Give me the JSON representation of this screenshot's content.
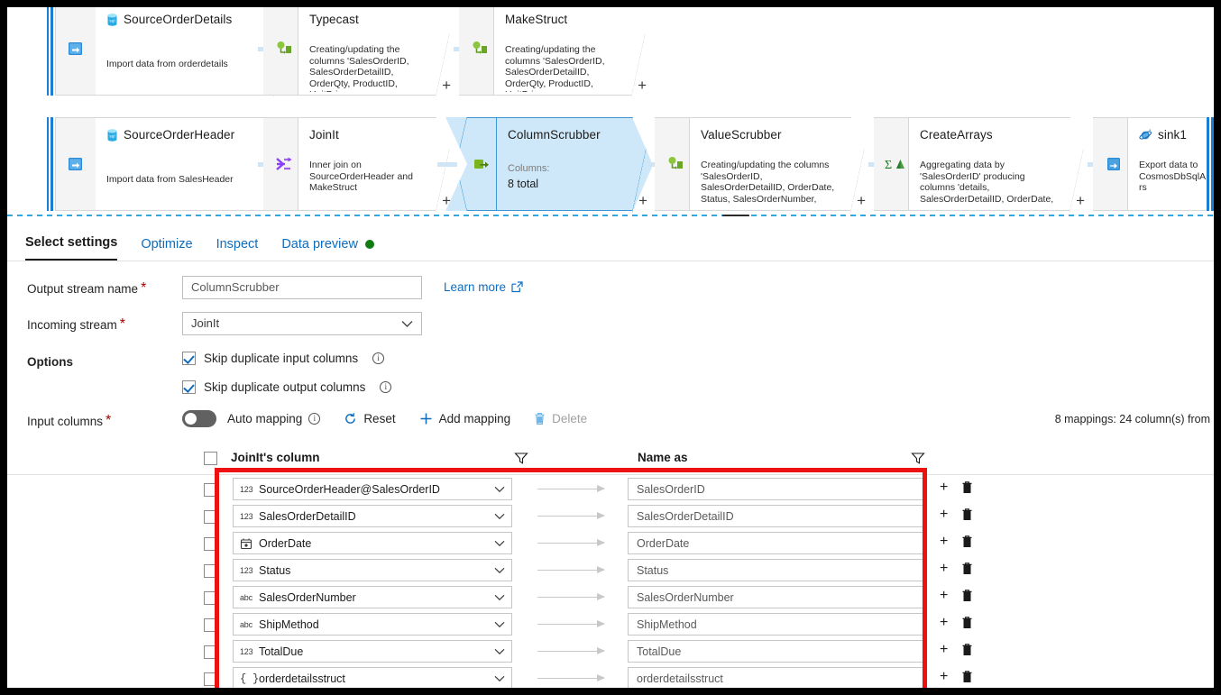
{
  "canvas": {
    "row1": [
      {
        "name": "SourceOrderDetails",
        "desc": "Import data from orderdetails",
        "icon": "sql-database-icon",
        "kind": "source"
      },
      {
        "name": "Typecast",
        "desc": "Creating/updating the columns 'SalesOrderID, SalesOrderDetailID, OrderQty, ProductID, UnitPrice,",
        "icon": "derived-column-icon",
        "kind": "transform"
      },
      {
        "name": "MakeStruct",
        "desc": "Creating/updating the columns 'SalesOrderID, SalesOrderDetailID, OrderQty, ProductID, UnitPrice,",
        "icon": "derived-column-icon",
        "kind": "transform"
      }
    ],
    "row2": [
      {
        "name": "SourceOrderHeader",
        "desc": "Import data from SalesHeader",
        "icon": "sql-database-icon",
        "kind": "source"
      },
      {
        "name": "JoinIt",
        "desc": "Inner join on SourceOrderHeader and MakeStruct",
        "icon": "join-icon",
        "kind": "transform"
      },
      {
        "name": "ColumnScrubber",
        "desc": "",
        "icon": "select-icon",
        "kind": "selected",
        "columns_label": "Columns:",
        "columns_value": "8 total"
      },
      {
        "name": "ValueScrubber",
        "desc": "Creating/updating the columns 'SalesOrderID, SalesOrderDetailID, OrderDate, Status, SalesOrderNumber,",
        "icon": "derived-column-icon",
        "kind": "transform"
      },
      {
        "name": "CreateArrays",
        "desc": "Aggregating data by 'SalesOrderID' producing columns 'details, SalesOrderDetailID, OrderDate,",
        "icon": "aggregate-icon",
        "kind": "transform"
      },
      {
        "name": "sink1",
        "desc": "Export data to CosmosDbSqlApiOrders",
        "icon": "cosmos-db-icon",
        "kind": "sink"
      }
    ],
    "plus_label": "+"
  },
  "tabs": [
    {
      "label": "Select settings",
      "active": true
    },
    {
      "label": "Optimize",
      "active": false
    },
    {
      "label": "Inspect",
      "active": false
    },
    {
      "label": "Data preview",
      "active": false,
      "indicator": "green-dot"
    }
  ],
  "form": {
    "output_stream_label": "Output stream name",
    "output_stream_value": "ColumnScrubber",
    "incoming_stream_label": "Incoming stream",
    "incoming_stream_value": "JoinIt",
    "learn_more": "Learn more",
    "options_label": "Options",
    "skip_dup_input": "Skip duplicate input columns",
    "skip_dup_output": "Skip duplicate output columns",
    "input_columns_label": "Input columns",
    "required_mark": "*",
    "info_glyph": "i"
  },
  "toolbar": {
    "auto_mapping": "Auto mapping",
    "reset": "Reset",
    "add_mapping": "Add mapping",
    "delete": "Delete",
    "mapping_count": "8 mappings: 24 column(s) from"
  },
  "table": {
    "col_source_header": "JoinIt's column",
    "col_target_header": "Name as",
    "rows": [
      {
        "type": "123",
        "source": "SourceOrderHeader@SalesOrderID",
        "target": "SalesOrderID"
      },
      {
        "type": "123",
        "source": "SalesOrderDetailID",
        "target": "SalesOrderDetailID"
      },
      {
        "type": "date",
        "source": "OrderDate",
        "target": "OrderDate"
      },
      {
        "type": "123",
        "source": "Status",
        "target": "Status"
      },
      {
        "type": "abc",
        "source": "SalesOrderNumber",
        "target": "SalesOrderNumber"
      },
      {
        "type": "abc",
        "source": "ShipMethod",
        "target": "ShipMethod"
      },
      {
        "type": "123",
        "source": "TotalDue",
        "target": "TotalDue"
      },
      {
        "type": "{}",
        "source": "orderdetailsstruct",
        "target": "orderdetailsstruct"
      }
    ]
  },
  "colors": {
    "accent_blue": "#0f6cbd",
    "selected_node_fill": "#cfe8f9",
    "selected_node_border": "#3a96d4",
    "annotation_red": "#ee1111",
    "status_green": "#107c10"
  }
}
